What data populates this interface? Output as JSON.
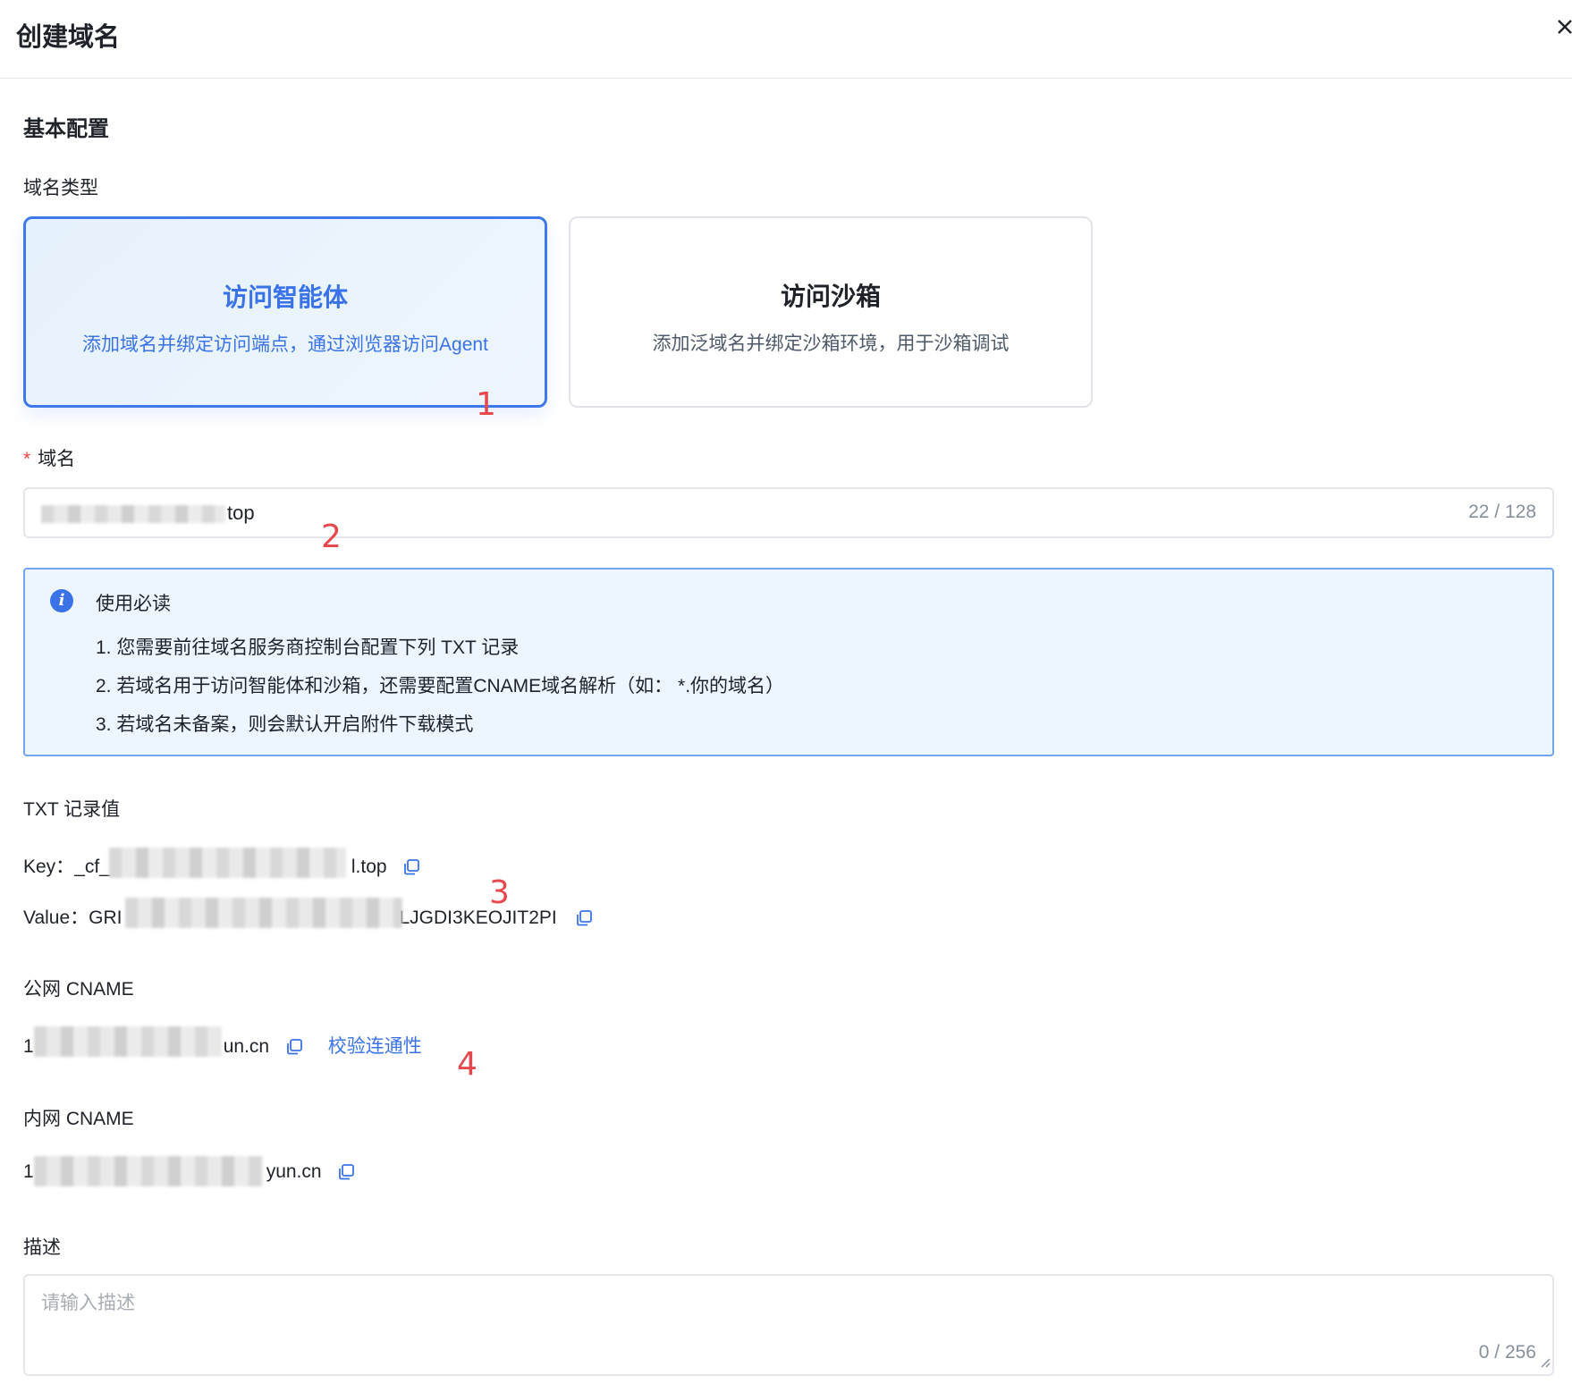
{
  "header": {
    "title": "创建域名"
  },
  "section": {
    "basic": "基本配置"
  },
  "domain_type": {
    "label": "域名类型",
    "cards": [
      {
        "title": "访问智能体",
        "desc": "添加域名并绑定访问端点，通过浏览器访问Agent",
        "selected": true
      },
      {
        "title": "访问沙箱",
        "desc": "添加泛域名并绑定沙箱环境，用于沙箱调试",
        "selected": false
      }
    ]
  },
  "annotations": [
    "1",
    "2",
    "3",
    "4"
  ],
  "domain_field": {
    "required_mark": "*",
    "label": "域名",
    "value_suffix": "top",
    "count": "22 / 128"
  },
  "notice": {
    "title": "使用必读",
    "items": [
      "1. 您需要前往域名服务商控制台配置下列 TXT 记录",
      "2. 若域名用于访问智能体和沙箱，还需要配置CNAME域名解析（如： *.你的域名）",
      "3. 若域名未备案，则会默认开启附件下载模式"
    ]
  },
  "txt": {
    "label": "TXT 记录值",
    "key_label": "Key：",
    "key_prefix": "_cf_",
    "key_suffix": "l.top",
    "value_label": "Value：",
    "value_prefix": "GRI",
    "value_suffix": "LJGDI3KEOJIT2PI"
  },
  "public_cname": {
    "label": "公网 CNAME",
    "prefix": "1",
    "suffix": "un.cn",
    "verify": "校验连通性"
  },
  "private_cname": {
    "label": "内网 CNAME",
    "prefix": "1",
    "suffix": "yun.cn"
  },
  "description": {
    "label": "描述",
    "placeholder": "请输入描述",
    "count": "0 / 256"
  },
  "colors": {
    "accent": "#3a73e8",
    "annotation": "#e5484d",
    "required": "#f53f3f"
  }
}
